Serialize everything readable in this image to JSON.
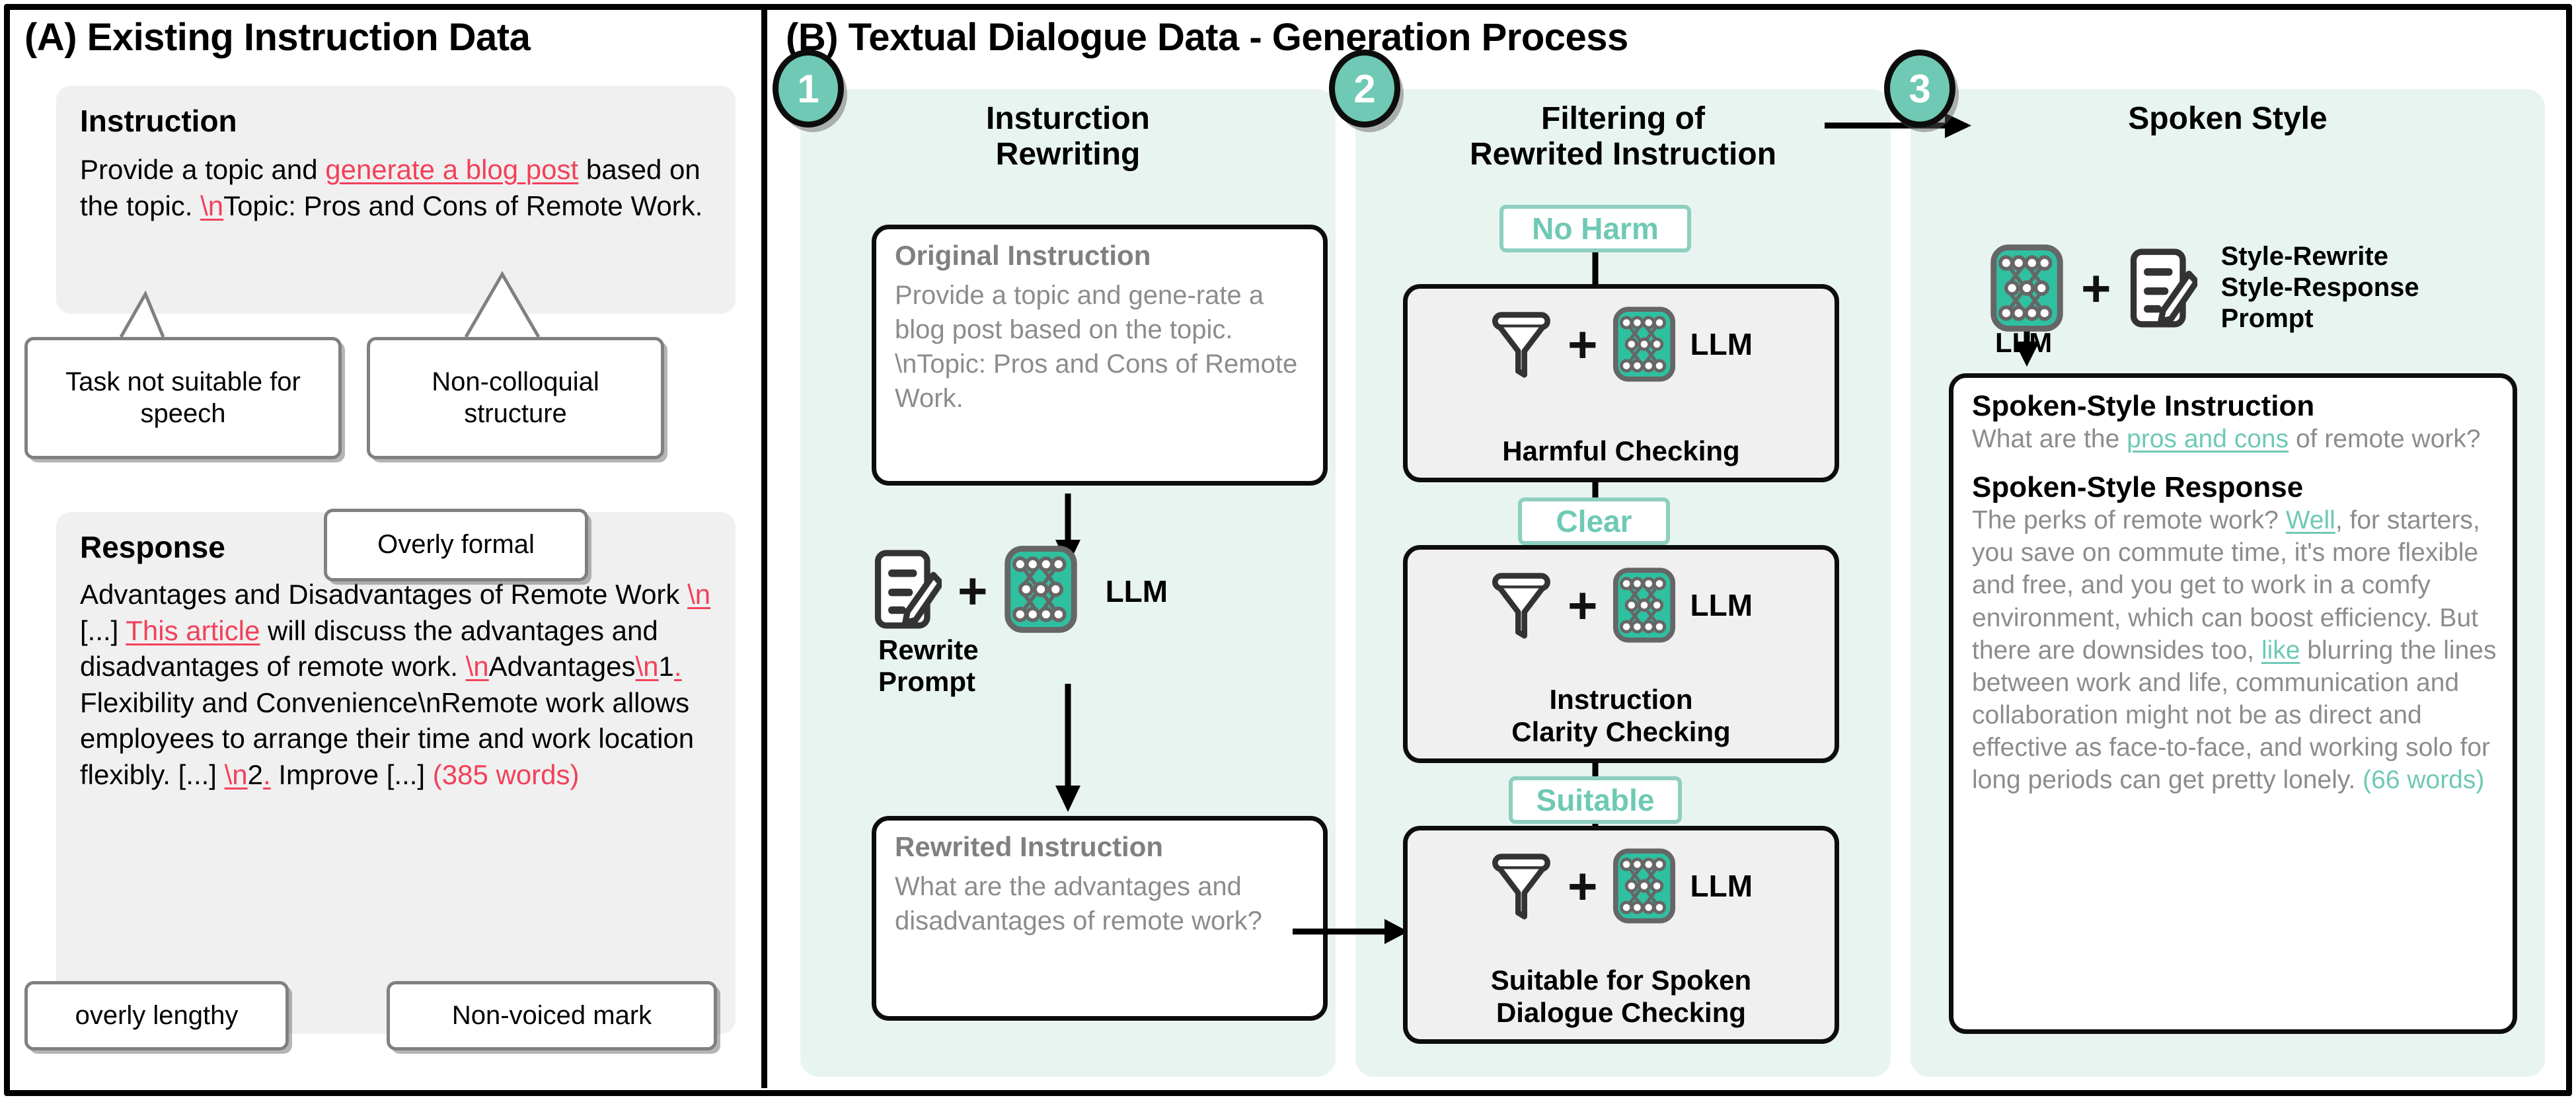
{
  "panelA": {
    "title": "(A) Existing Instruction Data",
    "instruction": {
      "heading": "Instruction",
      "t1": "Provide a topic and ",
      "t2": "generate a blog post",
      "t3": " based on the topic. ",
      "t4": "\\n",
      "t5": "Topic: Pros and Cons of Remote Work."
    },
    "response": {
      "heading": "Response",
      "t1": "Advantages and Disadvantages of Remote Work ",
      "t2": "\\n",
      "t3": " [...] ",
      "t4": "This article",
      "t5": " will discuss the advantages and disadvantages of remote work. ",
      "t6": "\\n",
      "t7": "Advantages",
      "t8": "\\n",
      "t9": "1",
      "t10": ".",
      "t11": " Flexibility and Convenience\\nRemote work allows employees to arrange their time and work location flexibly. [...] ",
      "t12": "\\n",
      "t13": "2",
      "t14": ".",
      "t15": " Improve [...] ",
      "t16": "(385 words)"
    },
    "callouts": {
      "task_not_suitable": "Task not suitable for speech",
      "non_colloquial": "Non-colloquial structure",
      "overly_formal": "Overly formal",
      "overly_lengthy": "overly lengthy",
      "non_voiced": "Non-voiced mark"
    }
  },
  "panelB": {
    "title": "(B) Textual Dialogue Data - Generation Process",
    "stage1": {
      "badge": "1",
      "title": "Insturction\nRewriting",
      "original": {
        "heading": "Original Instruction",
        "text": "Provide a topic and gene-rate a blog post based on the topic. \\nTopic: Pros and Cons of Remote Work."
      },
      "prompt_label": "Rewrite\nPrompt",
      "llm_label": "LLM",
      "plus": "+",
      "rewritten": {
        "heading": "Rewrited Instruction",
        "text": "What are the advantages and disadvantages of remote work?"
      }
    },
    "stage2": {
      "badge": "2",
      "title": "Filtering of\nRewrited Instruction",
      "pills": {
        "no_harm": "No Harm",
        "clear": "Clear",
        "suitable": "Suitable"
      },
      "checks": [
        {
          "label": "Harmful Checking",
          "llm_label": "LLM",
          "plus": "+"
        },
        {
          "label": "Instruction\nClarity Checking",
          "llm_label": "LLM",
          "plus": "+"
        },
        {
          "label": "Suitable for Spoken\nDialogue Checking",
          "llm_label": "LLM",
          "plus": "+"
        }
      ]
    },
    "stage3": {
      "badge": "3",
      "title": "Spoken Style",
      "llm_label": "LLM",
      "plus": "+",
      "prompt_label": "Style-Rewrite\nStyle-Response\nPrompt",
      "instruction": {
        "heading": "Spoken-Style Instruction",
        "t1": "What are the ",
        "t2": "pros and cons",
        "t3": " of remote work?"
      },
      "response": {
        "heading": "Spoken-Style Response",
        "t1": "The perks of remote work? ",
        "t2": "Well",
        "t3": ", for starters, you save on commute time, it's more flexible and free, and you get to work in a comfy environment, which can boost efficiency. But there are downsides too, ",
        "t4": "like",
        "t5": " blurring the lines between work and life, communication and collaboration might not be as direct and effective as face-to-face, and working solo for long periods can get pretty lonely. ",
        "t6": "(66 words)"
      }
    }
  },
  "colors": {
    "teal": "#6fc9b4",
    "teal_bg": "#e8f4f0",
    "red": "#f2415a",
    "gray_card": "#f0f0f0",
    "gray_text": "#8c8c8c"
  },
  "icons": {
    "llm": "neural-network-icon",
    "prompt": "document-pencil-icon",
    "filter": "funnel-icon"
  }
}
